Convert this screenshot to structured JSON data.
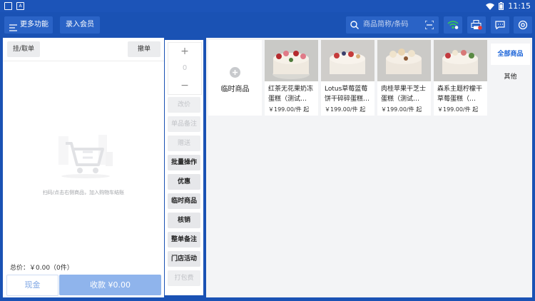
{
  "statusbar": {
    "time": "11:15",
    "left_icon_label": "A"
  },
  "topbar": {
    "more_functions": "更多功能",
    "add_member": "录入会员",
    "search_placeholder": "商品简称/条码"
  },
  "cart": {
    "hold_order": "挂/取单",
    "cancel_order": "撤单",
    "empty_hint": "扫码/点击右侧商品，加入购物车结账",
    "total_label": "总价：",
    "total_value": "￥0.00（0件）",
    "cash_button": "现金",
    "checkout_button": "收款 ¥0.00"
  },
  "qty": {
    "plus": "+",
    "value": "0",
    "minus": "−"
  },
  "actions": [
    {
      "label": "改价",
      "enabled": false
    },
    {
      "label": "单品备注",
      "enabled": false
    },
    {
      "label": "赠送",
      "enabled": false
    },
    {
      "label": "批量操作",
      "enabled": true
    },
    {
      "label": "优惠",
      "enabled": true
    },
    {
      "label": "临时商品",
      "enabled": true
    },
    {
      "label": "核销",
      "enabled": true
    },
    {
      "label": "整单备注",
      "enabled": true
    },
    {
      "label": "门店活动",
      "enabled": true
    },
    {
      "label": "打包费",
      "enabled": false
    }
  ],
  "temp_product": {
    "label": "临时商品"
  },
  "products": [
    {
      "name": "红茶无花果奶冻蛋糕（测试…",
      "price": "￥199.00/件 起"
    },
    {
      "name": "Lotus草莓蓝莓饼干碎碎蛋糕…",
      "price": "￥199.00/件 起"
    },
    {
      "name": "肉桂苹果干芝士蛋糕（测试…",
      "price": "￥199.00/件 起"
    },
    {
      "name": "森系主题柠檬干草莓蛋糕（…",
      "price": "￥199.00/件 起"
    }
  ],
  "categories": [
    {
      "label": "全部商品",
      "active": true
    },
    {
      "label": "其他",
      "active": false
    }
  ],
  "colors": {
    "primary": "#1a52b4",
    "accent": "#1a63d8",
    "checkout_disabled": "#8fb4ec"
  }
}
